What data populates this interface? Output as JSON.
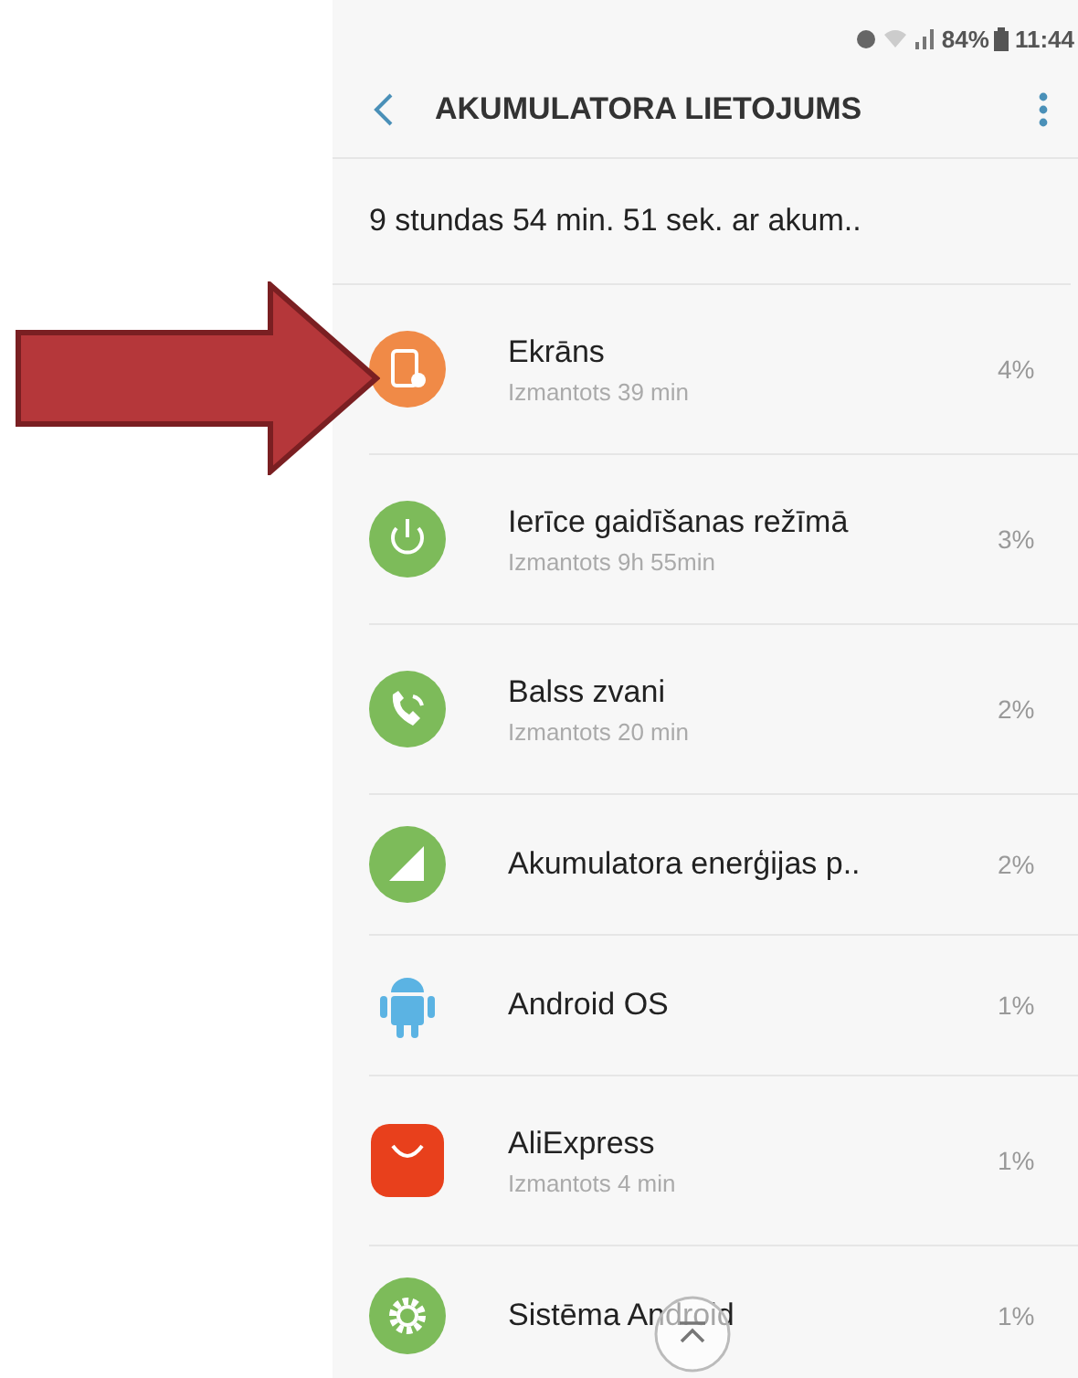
{
  "status_bar": {
    "battery": "84%",
    "time": "11:44"
  },
  "header": {
    "title": "AKUMULATORA LIETOJUMS"
  },
  "summary": "9 stundas 54 min. 51 sek. ar akum..",
  "apps": [
    {
      "kind": "screen",
      "name": "Ekrāns",
      "usage": "Izmantots 39 min",
      "percent": "4%"
    },
    {
      "kind": "power",
      "name": "Ierīce gaidīšanas režīmā",
      "usage": "Izmantots 9h 55min",
      "percent": "3%"
    },
    {
      "kind": "call",
      "name": "Balss zvani",
      "usage": "Izmantots 20 min",
      "percent": "2%"
    },
    {
      "kind": "battery",
      "name": "Akumulatora enerģijas p..",
      "percent": "2%"
    },
    {
      "kind": "android",
      "name": "Android OS",
      "percent": "1%"
    },
    {
      "kind": "aliexpress",
      "name": "AliExpress",
      "usage": "Izmantots 4 min",
      "percent": "1%"
    },
    {
      "kind": "gear",
      "name": "Sistēma Android",
      "percent": "1%"
    }
  ]
}
